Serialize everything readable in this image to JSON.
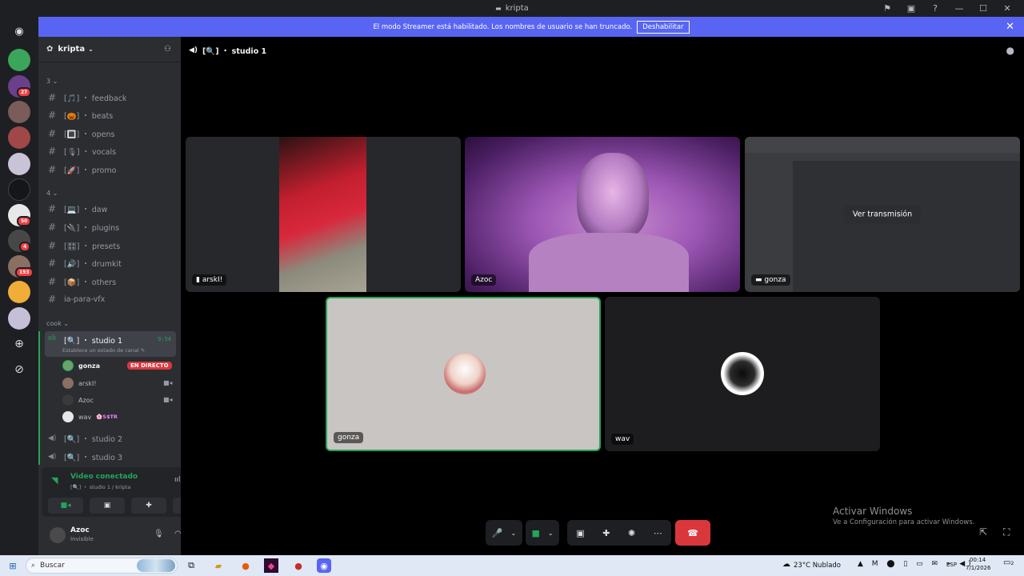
{
  "window": {
    "title": "kripta",
    "controls": [
      "minimize",
      "maximize",
      "close"
    ]
  },
  "banner": {
    "text": "El modo Streamer está habilitado. Los nombres de usuario se han truncado.",
    "button": "Deshabilitar"
  },
  "rail": {
    "badges": [
      "27",
      "50",
      "4",
      "193"
    ]
  },
  "guild": {
    "name": "kripta"
  },
  "categories": [
    {
      "label": "3",
      "channels": [
        "[🎵] ・ feedback",
        "[🎃] ・ beats",
        "[🔳] ・ opens",
        "[🎙] ・ vocals",
        "[🚀] ・ promo"
      ]
    },
    {
      "label": "4",
      "channels": [
        "[💻] ・ daw",
        "[🔌] ・ plugins",
        "[🎛] ・ presets",
        "[🔊] ・ drumkit",
        "[📦] ・ others",
        "ia-para-vfx"
      ]
    },
    {
      "label": "cook"
    }
  ],
  "voice": {
    "active_channel": "[🔍] ・ studio 1",
    "active_time": "9:54",
    "status_prompt": "Establece un estado de canal",
    "members": [
      {
        "name": "gonza",
        "tag": "EN DIRECTO"
      },
      {
        "name": "arskI!"
      },
      {
        "name": "Azoc"
      },
      {
        "name": "wav",
        "tag": "🌸S$TR"
      }
    ],
    "other_channels": [
      "[🔍] ・ studio 2",
      "[🔍] ・ studio 3"
    ]
  },
  "voice_panel": {
    "status": "Video conectado",
    "location": "[🔍] ・ studio 1 / kripta"
  },
  "user_panel": {
    "name": "Azoc",
    "status": "Invisible"
  },
  "main": {
    "channel": "[🔍] ・ studio 1",
    "tiles": [
      {
        "label": "arskI!"
      },
      {
        "label": "Azoc"
      },
      {
        "label": "gonza",
        "action": "Ver transmisión"
      },
      {
        "label": "gonza"
      },
      {
        "label": "wav"
      }
    ]
  },
  "watermark": {
    "line1": "Activar Windows",
    "line2": "Ve a Configuración para activar Windows."
  },
  "taskbar": {
    "search_placeholder": "Buscar",
    "weather": "23°C  Nublado",
    "lang": "ESP",
    "time": "00:14",
    "date": "7/1/2026",
    "notif_count": "2"
  },
  "colors": {
    "blurple": "#5865f2",
    "green": "#23a55a",
    "red": "#da373c"
  }
}
